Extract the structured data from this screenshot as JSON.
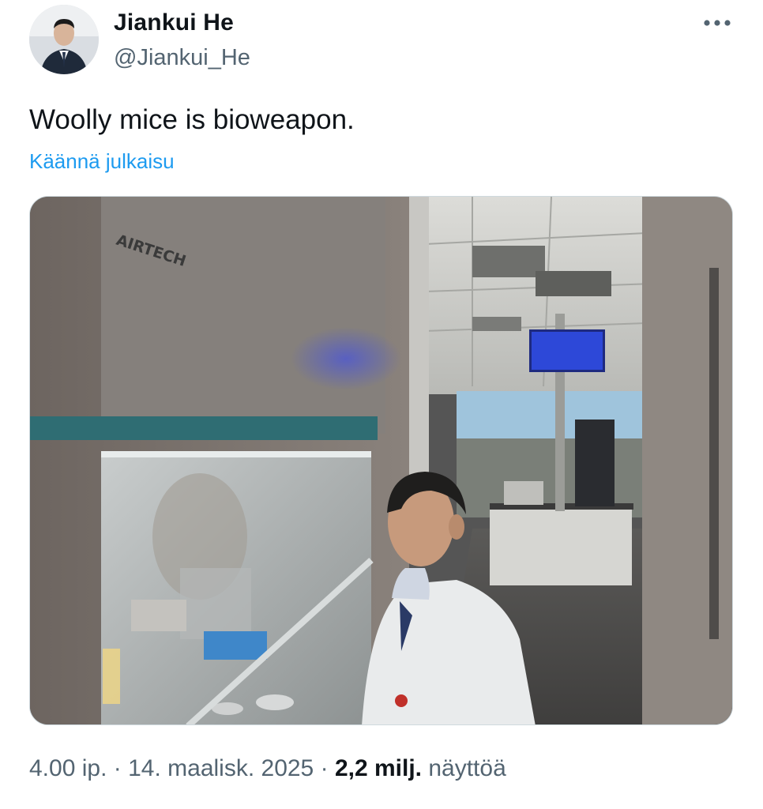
{
  "author": {
    "display_name": "Jiankui He",
    "handle": "@Jiankui_He",
    "avatar_icon": "profile-photo"
  },
  "more_icon": "more-horizontal-icon",
  "tweet": {
    "text": "Woolly mice is bioweapon.",
    "translate_label": "Käännä julkaisu"
  },
  "media": {
    "sign_text": "AIRTECH"
  },
  "meta": {
    "time": "4.00 ip.",
    "separator": "·",
    "date": "14. maalisk. 2025",
    "views_count": "2,2 milj.",
    "views_label": "näyttöä"
  },
  "colors": {
    "link": "#1d9bf0",
    "secondary_text": "#536471",
    "primary_text": "#0f1419"
  }
}
